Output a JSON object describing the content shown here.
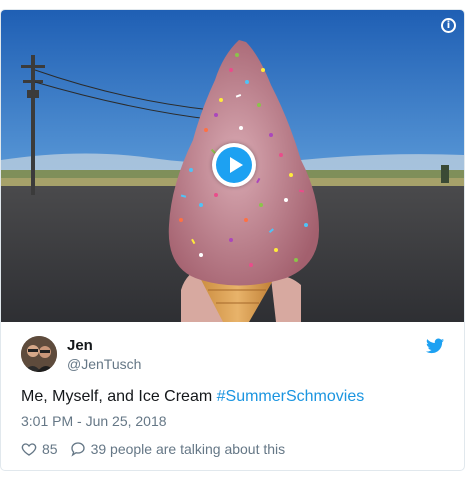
{
  "media": {
    "info_icon": "info-icon",
    "play_icon": "play-icon",
    "accent_color": "#1da1f2"
  },
  "tweet": {
    "author_name": "Jen",
    "author_handle": "@JenTusch",
    "text_prefix": "Me, Myself, and Ice Cream ",
    "hashtag": "#SummerSchmovies",
    "timestamp": "3:01 PM - Jun 25, 2018",
    "like_count": "85",
    "talking_text": "39 people are talking about this",
    "hashtag_color": "#1b95e0",
    "brand_icon": "twitter-bird-icon"
  }
}
